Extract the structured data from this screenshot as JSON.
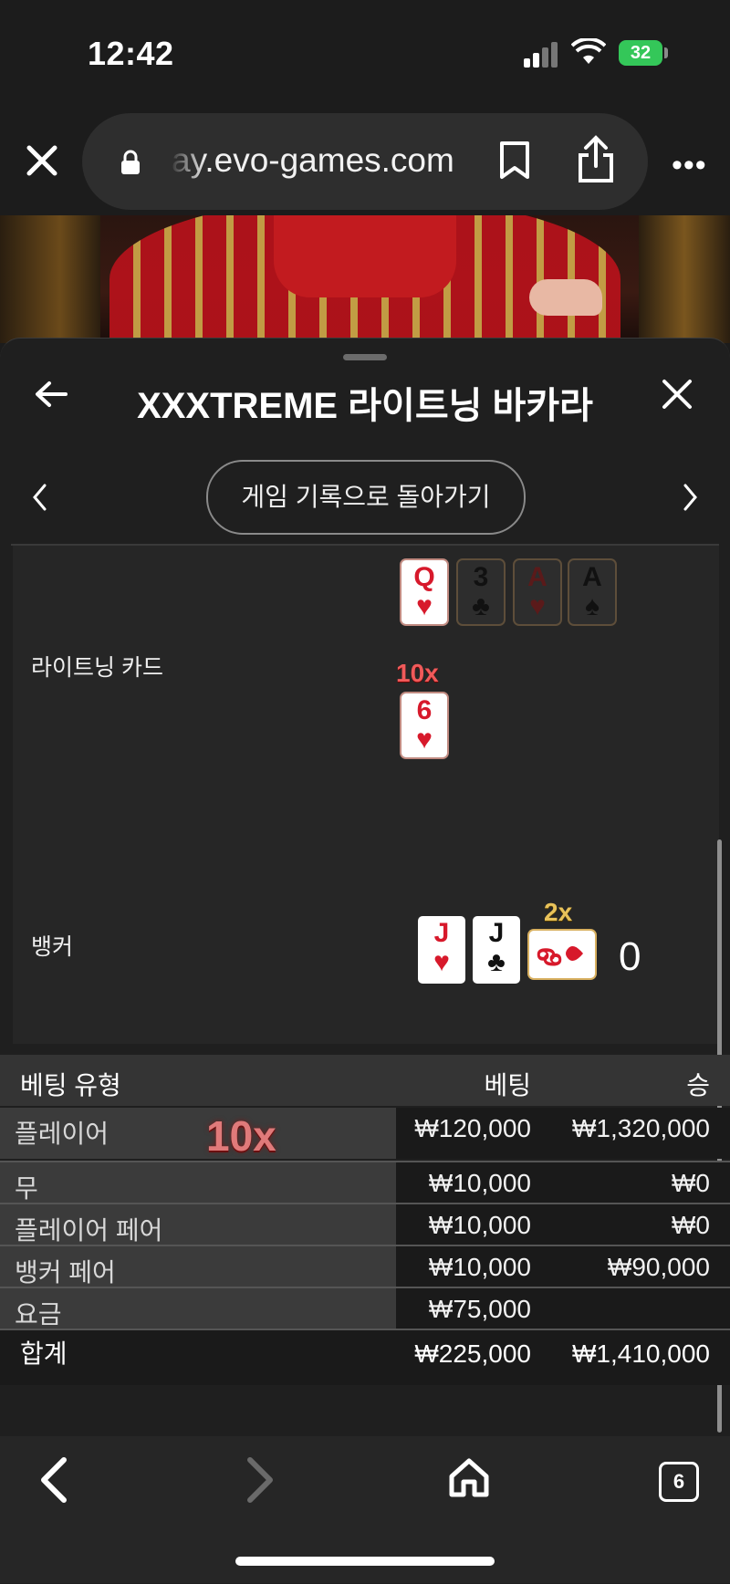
{
  "status_bar": {
    "time": "12:42",
    "battery": "32"
  },
  "browser": {
    "url": "ay.evo-games.com",
    "tabs_count": "6"
  },
  "sheet": {
    "title": "XXXTREME 라이트닝 바카라",
    "back_to_history": "게임 기록으로 돌아가기"
  },
  "cards_area": {
    "lightning_label": "라이트닝 카드",
    "banker_label": "뱅커",
    "lightning_top_cards": [
      {
        "rank": "Q",
        "suit": "♥"
      },
      {
        "rank": "3",
        "suit": "♣"
      },
      {
        "rank": "A",
        "suit": "♥"
      },
      {
        "rank": "A",
        "suit": "♠"
      }
    ],
    "lightning_multiplier": "10x",
    "lightning_card": {
      "rank": "6",
      "suit": "♥"
    },
    "banker_cards": [
      {
        "rank": "J",
        "suit": "♥"
      },
      {
        "rank": "J",
        "suit": "♣"
      }
    ],
    "banker_multiplier": "2x",
    "banker_score": "0"
  },
  "bets_table": {
    "headers": {
      "type": "베팅 유형",
      "bet": "베팅",
      "win": "승"
    },
    "player_multiplier": "10x",
    "rows": [
      {
        "name": "플레이어",
        "bet": "₩120,000",
        "win": "₩1,320,000"
      },
      {
        "name": "무",
        "bet": "₩10,000",
        "win": "₩0"
      },
      {
        "name": "플레이어 페어",
        "bet": "₩10,000",
        "win": "₩0"
      },
      {
        "name": "뱅커 페어",
        "bet": "₩10,000",
        "win": "₩90,000"
      },
      {
        "name": "요금",
        "bet": "₩75,000",
        "win": ""
      }
    ],
    "total": {
      "label": "합계",
      "bet": "₩225,000",
      "win": "₩1,410,000"
    }
  }
}
